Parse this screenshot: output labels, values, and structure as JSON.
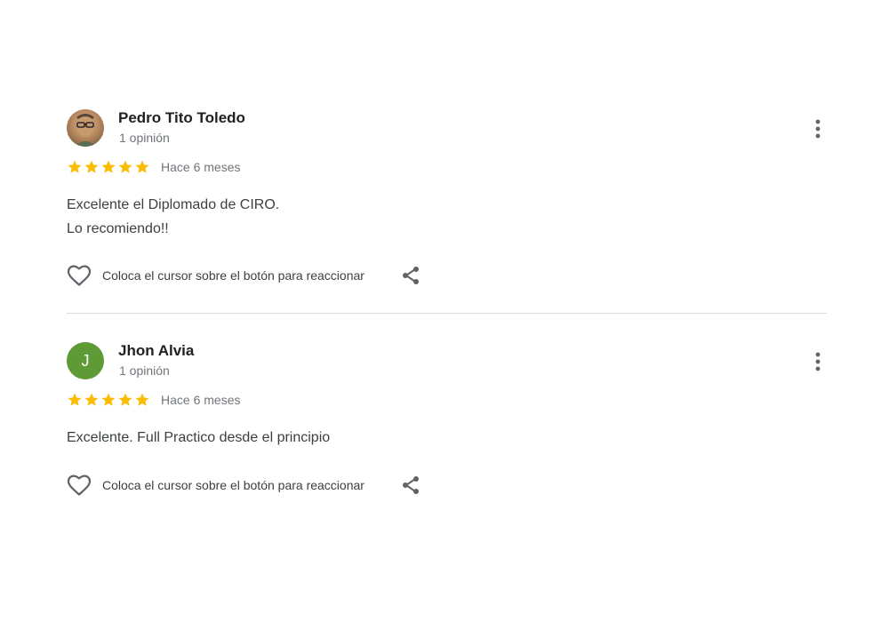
{
  "reviews": [
    {
      "author": "Pedro Tito Toledo",
      "review_count": "1 opinión",
      "rating": 5,
      "date": "Hace 6 meses",
      "text": "Excelente el Diplomado de CIRO.\nLo recomiendo!!",
      "avatar": {
        "type": "photo"
      },
      "react_label": "Coloca el cursor sobre el botón para reaccionar"
    },
    {
      "author": "Jhon Alvia",
      "review_count": "1 opinión",
      "rating": 5,
      "date": "Hace 6 meses",
      "text": "Excelente. Full Practico desde el principio",
      "avatar": {
        "type": "letter",
        "letter": "J",
        "color": "#5e9a35"
      },
      "react_label": "Coloca el cursor sobre el botón para reaccionar"
    }
  ],
  "colors": {
    "star": "#fbbc04",
    "icon": "#5f6368",
    "divider": "#dadce0"
  },
  "icons": {
    "more": "more-vert-icon",
    "heart": "heart-outline-icon",
    "share": "share-icon",
    "star": "star-icon"
  }
}
